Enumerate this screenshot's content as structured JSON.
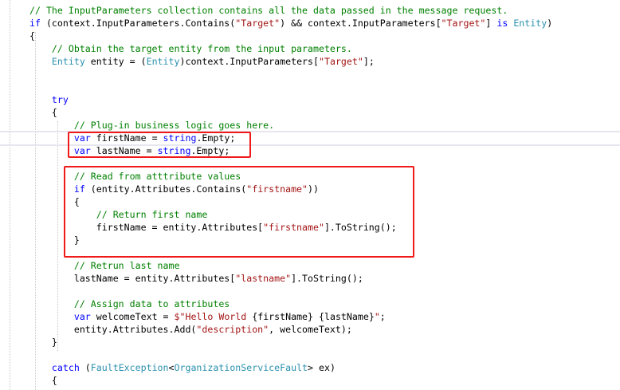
{
  "colors": {
    "comment": "#008000",
    "keyword": "#0000ff",
    "type": "#2b91af",
    "string": "#a31515",
    "text": "#000000",
    "highlight_box": "#f01a1a"
  },
  "code_lines": [
    [
      [
        "comment",
        "// The InputParameters collection contains all the data passed in the message request."
      ]
    ],
    [
      [
        "keyword",
        "if"
      ],
      [
        "text",
        " (context.InputParameters.Contains("
      ],
      [
        "string",
        "\"Target\""
      ],
      [
        "text",
        ") && context.InputParameters["
      ],
      [
        "string",
        "\"Target\""
      ],
      [
        "text",
        "] "
      ],
      [
        "keyword",
        "is"
      ],
      [
        "text",
        " "
      ],
      [
        "type",
        "Entity"
      ],
      [
        "text",
        ")"
      ]
    ],
    [
      [
        "text",
        "{"
      ]
    ],
    [
      [
        "text",
        "    "
      ],
      [
        "comment",
        "// Obtain the target entity from the input parameters."
      ]
    ],
    [
      [
        "text",
        "    "
      ],
      [
        "type",
        "Entity"
      ],
      [
        "text",
        " entity = ("
      ],
      [
        "type",
        "Entity"
      ],
      [
        "text",
        ")context.InputParameters["
      ],
      [
        "string",
        "\"Target\""
      ],
      [
        "text",
        "];"
      ]
    ],
    [],
    [],
    [
      [
        "text",
        "    "
      ],
      [
        "keyword",
        "try"
      ]
    ],
    [
      [
        "text",
        "    {"
      ]
    ],
    [
      [
        "text",
        "        "
      ],
      [
        "comment",
        "// Plug-in business logic goes here."
      ]
    ],
    [
      [
        "text",
        "        "
      ],
      [
        "keyword",
        "var"
      ],
      [
        "text",
        " firstName = "
      ],
      [
        "keyword",
        "string"
      ],
      [
        "text",
        ".Empty;"
      ]
    ],
    [
      [
        "text",
        "        "
      ],
      [
        "keyword",
        "var"
      ],
      [
        "text",
        " lastName = "
      ],
      [
        "keyword",
        "string"
      ],
      [
        "text",
        ".Empty;"
      ]
    ],
    [],
    [
      [
        "text",
        "        "
      ],
      [
        "comment",
        "// Read from atttribute values"
      ]
    ],
    [
      [
        "text",
        "        "
      ],
      [
        "keyword",
        "if"
      ],
      [
        "text",
        " (entity.Attributes.Contains("
      ],
      [
        "string",
        "\"firstname\""
      ],
      [
        "text",
        "))"
      ]
    ],
    [
      [
        "text",
        "        {"
      ]
    ],
    [
      [
        "text",
        "            "
      ],
      [
        "comment",
        "// Return first name"
      ]
    ],
    [
      [
        "text",
        "            firstName = entity.Attributes["
      ],
      [
        "string",
        "\"firstname\""
      ],
      [
        "text",
        "].ToString();"
      ]
    ],
    [
      [
        "text",
        "        }"
      ]
    ],
    [],
    [
      [
        "text",
        "        "
      ],
      [
        "comment",
        "// Retrun last name"
      ]
    ],
    [
      [
        "text",
        "        lastName = entity.Attributes["
      ],
      [
        "string",
        "\"lastname\""
      ],
      [
        "text",
        "].ToString();"
      ]
    ],
    [],
    [
      [
        "text",
        "        "
      ],
      [
        "comment",
        "// Assign data to attributes"
      ]
    ],
    [
      [
        "text",
        "        "
      ],
      [
        "keyword",
        "var"
      ],
      [
        "text",
        " welcomeText = "
      ],
      [
        "string",
        "$\"Hello World "
      ],
      [
        "text",
        "{firstName}"
      ],
      [
        "string",
        " "
      ],
      [
        "text",
        "{lastName}"
      ],
      [
        "string",
        "\""
      ],
      [
        "text",
        ";"
      ]
    ],
    [
      [
        "text",
        "        entity.Attributes.Add("
      ],
      [
        "string",
        "\"description\""
      ],
      [
        "text",
        ", welcomeText);"
      ]
    ],
    [
      [
        "text",
        "    }"
      ]
    ],
    [],
    [
      [
        "text",
        "    "
      ],
      [
        "keyword",
        "catch"
      ],
      [
        "text",
        " ("
      ],
      [
        "type",
        "FaultException"
      ],
      [
        "text",
        "<"
      ],
      [
        "type",
        "OrganizationServiceFault"
      ],
      [
        "text",
        "> ex)"
      ]
    ],
    [
      [
        "text",
        "    {"
      ]
    ]
  ]
}
